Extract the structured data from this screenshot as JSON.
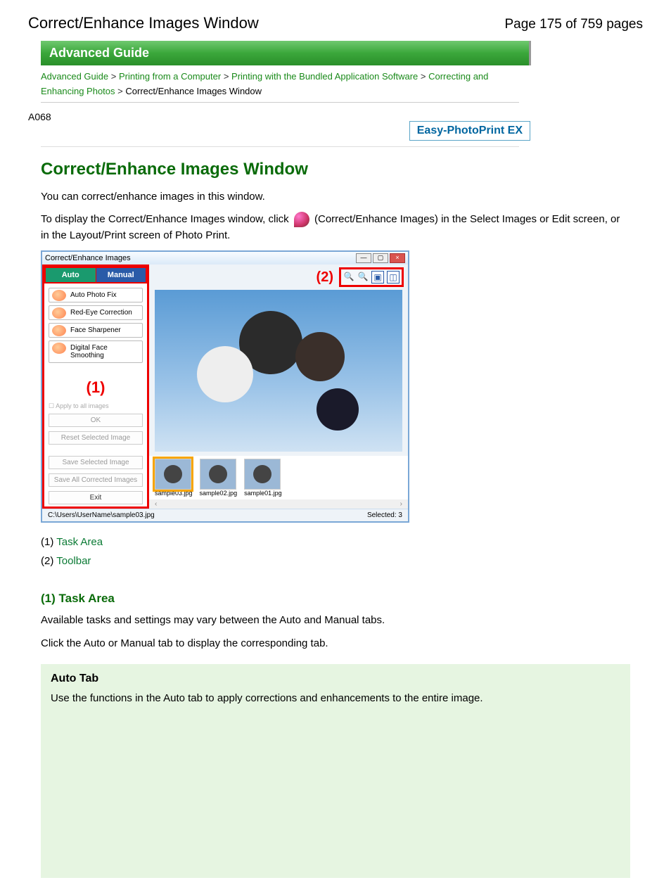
{
  "header": {
    "title": "Correct/Enhance Images Window",
    "page_info": "Page 175 of 759 pages"
  },
  "banner": "Advanced Guide",
  "breadcrumb": {
    "items": [
      "Advanced Guide",
      "Printing from a Computer",
      "Printing with the Bundled Application Software",
      "Correcting and Enhancing Photos"
    ],
    "current": "Correct/Enhance Images Window",
    "sep": ">"
  },
  "code_id": "A068",
  "product_badge": "Easy-PhotoPrint EX",
  "section_title": "Correct/Enhance Images Window",
  "intro_p1": "You can correct/enhance images in this window.",
  "intro_p2a": "To display the Correct/Enhance Images window, click ",
  "intro_p2b": " (Correct/Enhance Images) in the Select Images or Edit screen, or in the Layout/Print screen of Photo Print.",
  "app": {
    "title": "Correct/Enhance Images",
    "tabs": {
      "auto": "Auto",
      "manual": "Manual"
    },
    "tasks": [
      "Auto Photo Fix",
      "Red-Eye Correction",
      "Face Sharpener",
      "Digital Face Smoothing"
    ],
    "num1": "(1)",
    "apply_all": "Apply to all images",
    "ok": "OK",
    "reset": "Reset Selected Image",
    "save_sel": "Save Selected Image",
    "save_all": "Save All Corrected Images",
    "exit": "Exit",
    "num2": "(2)",
    "thumbs": [
      "sample03.jpg",
      "sample02.jpg",
      "sample01.jpg"
    ],
    "scroll_l": "‹",
    "scroll_r": "›",
    "status_path": "C:\\Users\\UserName\\sample03.jpg",
    "status_sel": "Selected: 3"
  },
  "links": {
    "l1_num": "(1) ",
    "l1": "Task Area",
    "l2_num": "(2) ",
    "l2": "Toolbar"
  },
  "task_area": {
    "heading": "(1) Task Area",
    "p1": "Available tasks and settings may vary between the Auto and Manual tabs.",
    "p2": "Click the Auto or Manual tab to display the corresponding tab."
  },
  "auto_tab": {
    "heading": "Auto Tab",
    "p1": "Use the functions in the Auto tab to apply corrections and enhancements to the entire image."
  }
}
